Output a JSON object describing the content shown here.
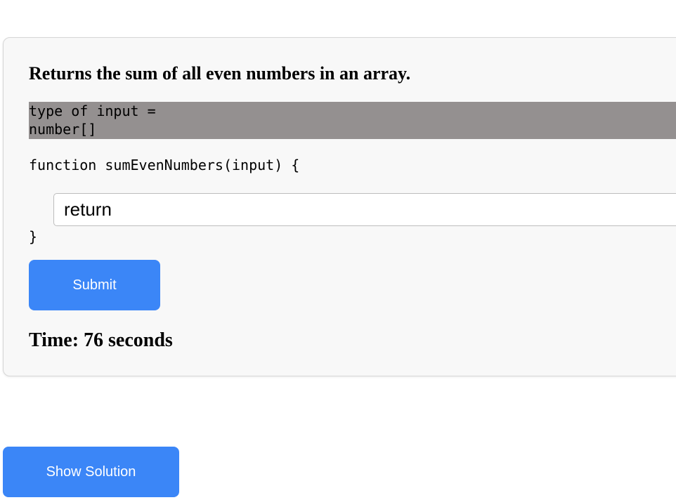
{
  "problem": {
    "title": "Returns the sum of all even numbers in an array.",
    "type_lines": [
      "type of input =",
      "number[]"
    ],
    "function_signature": "function sumEvenNumbers(input) {",
    "closing_brace": "}"
  },
  "answer": {
    "value": "return"
  },
  "buttons": {
    "submit_label": "Submit",
    "show_solution_label": "Show Solution"
  },
  "timer": {
    "text": "Time: 76 seconds"
  },
  "colors": {
    "accent": "#3b86f7",
    "type_box": "#949090",
    "card_bg": "#f8f8f8"
  }
}
